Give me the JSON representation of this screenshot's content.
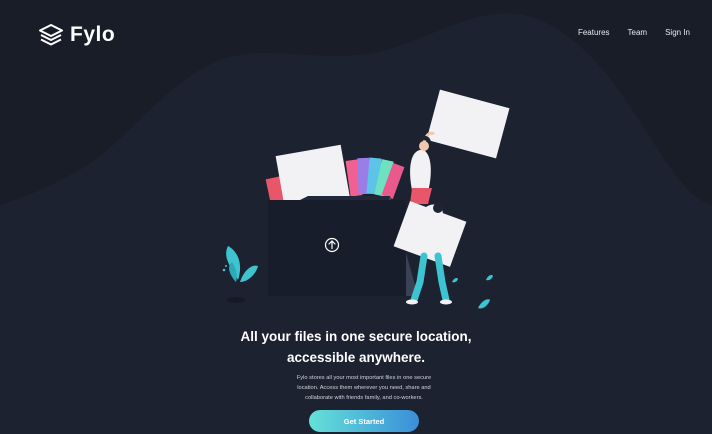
{
  "brand": {
    "name": "Fylo",
    "icon": "stacked-layers-icon"
  },
  "nav": {
    "items": [
      {
        "label": "Features"
      },
      {
        "label": "Team"
      },
      {
        "label": "Sign In"
      }
    ]
  },
  "hero": {
    "headline_line1": "All your files in one secure location,",
    "headline_line2": "accessible anywhere.",
    "body_line1": "Fylo stores all your most important files in one secure",
    "body_line2": "location. Access them wherever you need, share and",
    "body_line3": "collaborate with friends family, and co-workers.",
    "cta_label": "Get Started"
  },
  "colors": {
    "background": "#1c2230",
    "wave": "#181d28",
    "accent_start": "#64e1d9",
    "accent_end": "#3b8ed8"
  },
  "illustration": {
    "icons": [
      "upload-arrow-icon",
      "folder-illustration",
      "person-illustration",
      "plant-illustration"
    ]
  }
}
